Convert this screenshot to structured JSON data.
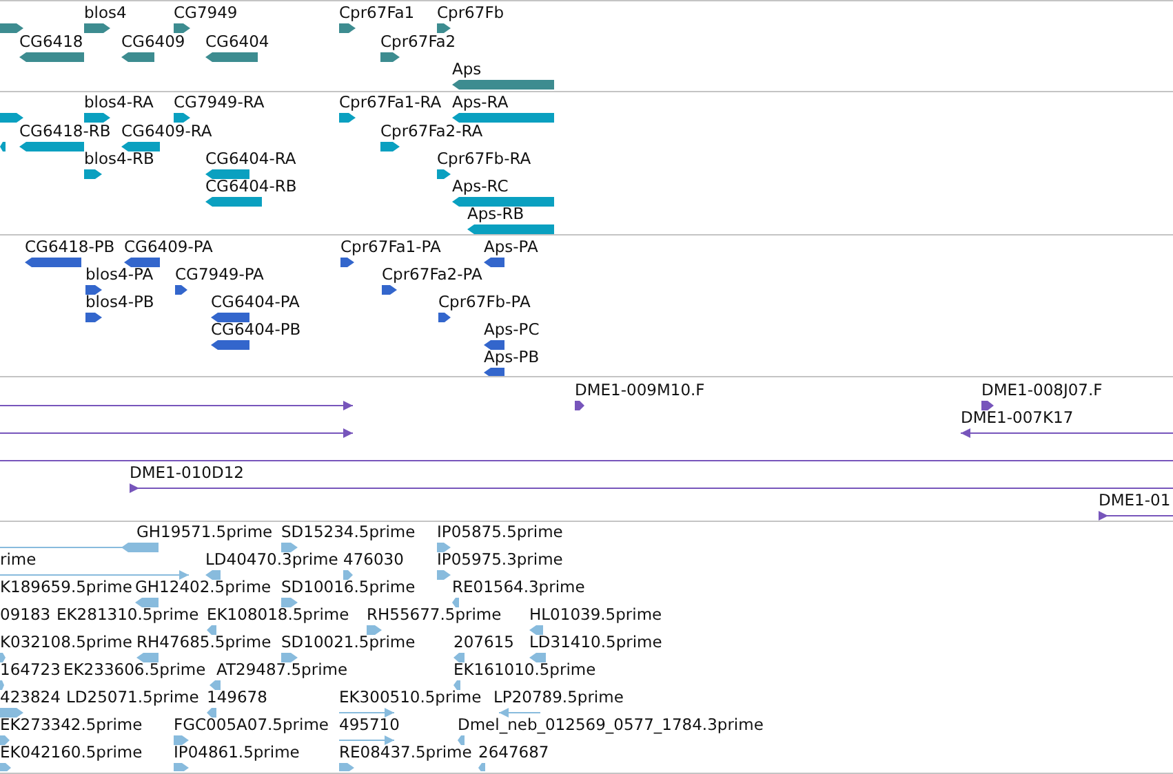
{
  "tracks": [
    {
      "color": "#3d8c90",
      "features": [
        {
          "reverse": false
        },
        {
          "label": "blos4",
          "reverse": false
        },
        {
          "label": "CG7949",
          "reverse": false
        },
        {
          "label": "Cpr67Fa1",
          "reverse": false
        },
        {
          "label": "Cpr67Fb",
          "reverse": false
        },
        {
          "label": "CG6418",
          "reverse": true
        },
        {
          "label": "CG6409",
          "reverse": true
        },
        {
          "label": "CG6404",
          "reverse": true
        },
        {
          "label": "Cpr67Fa2",
          "reverse": false
        },
        {
          "label": "Aps",
          "reverse": true
        }
      ]
    },
    {
      "color": "#0aa0c0",
      "features": [
        {
          "reverse": false
        },
        {
          "label": "blos4-RA",
          "reverse": false
        },
        {
          "label": "CG7949-RA",
          "reverse": false
        },
        {
          "label": "Cpr67Fa1-RA",
          "reverse": false
        },
        {
          "label": "Aps-RA",
          "reverse": true
        },
        {
          "reverse": true
        },
        {
          "label": "CG6418-RB",
          "reverse": true
        },
        {
          "label": "CG6409-RA",
          "reverse": true
        },
        {
          "label": "Cpr67Fa2-RA",
          "reverse": false
        },
        {
          "label": "blos4-RB",
          "reverse": false
        },
        {
          "label": "CG6404-RA",
          "reverse": true
        },
        {
          "label": "Cpr67Fb-RA",
          "reverse": false
        },
        {
          "label": "CG6404-RB",
          "reverse": true
        },
        {
          "label": "Aps-RC",
          "reverse": true
        },
        {
          "label": "Aps-RB",
          "reverse": true
        }
      ]
    },
    {
      "color": "#3366cc",
      "features": [
        {
          "label": "CG6418-PB",
          "reverse": true
        },
        {
          "label": "CG6409-PA",
          "reverse": true
        },
        {
          "label": "Cpr67Fa1-PA",
          "reverse": false
        },
        {
          "label": "Aps-PA",
          "reverse": true
        },
        {
          "label": "blos4-PA",
          "reverse": false
        },
        {
          "label": "CG7949-PA",
          "reverse": false
        },
        {
          "label": "Cpr67Fa2-PA",
          "reverse": false
        },
        {
          "label": "blos4-PB",
          "reverse": false
        },
        {
          "label": "CG6404-PA",
          "reverse": true
        },
        {
          "label": "Cpr67Fb-PA",
          "reverse": false
        },
        {
          "label": "CG6404-PB",
          "reverse": true
        },
        {
          "label": "Aps-PC",
          "reverse": true
        },
        {
          "label": "Aps-PB",
          "reverse": true
        }
      ]
    },
    {
      "color": "#7755bb",
      "features": [
        {
          "reverse": false
        },
        {
          "label": "DME1-009M10.F",
          "reverse": false
        },
        {
          "label": "DME1-008J07.F",
          "reverse": false
        },
        {
          "reverse": false
        },
        {
          "label": "DME1-007K17",
          "reverse": true
        },
        {
          "arrowhead": false
        },
        {
          "label": "DME1-010D12",
          "reverse": false
        },
        {
          "label": "DME1-01",
          "reverse": false
        }
      ]
    },
    {
      "color": "#88bbdd",
      "features": [
        {
          "arrowhead": false
        },
        {
          "label": "GH19571.5prime",
          "reverse": true
        },
        {
          "label": "SD15234.5prime",
          "reverse": false
        },
        {
          "label": "IP05875.5prime",
          "reverse": false
        },
        {
          "label": "rime",
          "reverse": false
        },
        {
          "label": "LD40470.3prime",
          "reverse": true
        },
        {
          "label": "476030",
          "reverse": false
        },
        {
          "label": "IP05975.3prime",
          "reverse": false
        },
        {
          "label": "K189659.5prime"
        },
        {
          "label": "GH12402.5prime",
          "reverse": true
        },
        {
          "label": "SD10016.5prime",
          "reverse": false
        },
        {
          "label": "RE01564.3prime",
          "reverse": true
        },
        {
          "label": "09183"
        },
        {
          "label": "EK281310.5prime"
        },
        {
          "label": "EK108018.5prime",
          "reverse": true
        },
        {
          "label": "RH55677.5prime",
          "reverse": false
        },
        {
          "label": "HL01039.5prime",
          "reverse": true
        },
        {
          "label": "K032108.5prime",
          "reverse": false
        },
        {
          "label": "RH47685.5prime",
          "reverse": true
        },
        {
          "label": "SD10021.5prime",
          "reverse": false
        },
        {
          "label": "207615",
          "reverse": true
        },
        {
          "label": "LD31410.5prime",
          "reverse": true
        },
        {
          "label": "164723",
          "reverse": false
        },
        {
          "label": "EK233606.5prime"
        },
        {
          "label": "AT29487.5prime",
          "reverse": true
        },
        {
          "label": "EK161010.5prime",
          "reverse": true
        },
        {
          "label": "423824",
          "reverse": false
        },
        {
          "label": "LD25071.5prime"
        },
        {
          "label": "149678",
          "reverse": true
        },
        {
          "label": "EK300510.5prime",
          "reverse": false
        },
        {
          "label": "LP20789.5prime",
          "reverse": true
        },
        {
          "label": "EK273342.5prime",
          "reverse": false
        },
        {
          "label": "FGC005A07.5prime",
          "reverse": false
        },
        {
          "label": "495710",
          "reverse": false
        },
        {
          "label": "Dmel_neb_012569_0577_1784.3prime",
          "reverse": true
        },
        {
          "label": "EK042160.5prime",
          "reverse": false
        },
        {
          "label": "IP04861.5prime",
          "reverse": false
        },
        {
          "label": "RE08437.5prime",
          "reverse": false
        },
        {
          "label": "2647687",
          "reverse": true
        }
      ]
    }
  ]
}
